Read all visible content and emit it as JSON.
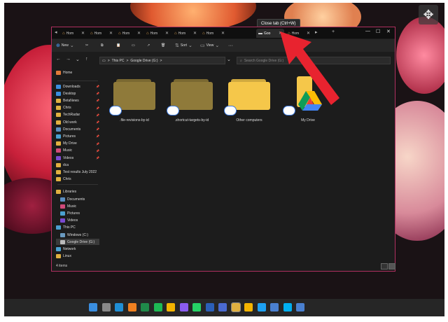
{
  "tooltip": "Close tab (Ctrl+W)",
  "tabs": [
    {
      "label": "Hom",
      "active": false
    },
    {
      "label": "Hom",
      "active": false
    },
    {
      "label": "Hom",
      "active": false
    },
    {
      "label": "Hom",
      "active": false
    },
    {
      "label": "Hom",
      "active": false
    },
    {
      "label": "Hom",
      "active": false
    },
    {
      "label": "Goo",
      "active": true
    },
    {
      "label": "Hom",
      "active": false
    }
  ],
  "toolbar": {
    "new_label": "New",
    "sort_label": "Sort",
    "view_label": "View",
    "more_label": "···"
  },
  "address": {
    "parts": [
      "This PC",
      "Google Drive (G:)"
    ],
    "separator": ">"
  },
  "search": {
    "placeholder": "Search Google Drive (G:)"
  },
  "sidebar": {
    "home": "Home",
    "quick": [
      "Downloads",
      "Desktop",
      "BetaNews",
      "Chris",
      "TechRadar",
      "Old work",
      "Documents",
      "Pictures",
      "My Drive",
      "Music",
      "Videos",
      "dca",
      "Test results July 2022",
      "Chris"
    ],
    "libraries": "Libraries",
    "lib_items": [
      "Documents",
      "Music",
      "Pictures",
      "Videos"
    ],
    "this_pc": "This PC",
    "pc_items": [
      "Windows (C:)",
      "Google Drive (G:)"
    ],
    "network": "Network",
    "linux": "Linux"
  },
  "folders": [
    {
      "label": ".file-revisions-by-id",
      "faded": true
    },
    {
      "label": ".shortcut-targets-by-id",
      "faded": true
    },
    {
      "label": "Other computers",
      "faded": false
    },
    {
      "label": "My Drive",
      "faded": false,
      "drive": true
    }
  ],
  "status": "4 items",
  "colors": {
    "accent": "#b03060",
    "folder": "#f5c74a",
    "folder_faded": "#8f7a3a",
    "arrow": "#e8232f"
  },
  "taskbar_icons": [
    "windows",
    "settings",
    "edge",
    "vlc",
    "excel",
    "spotify",
    "chrome",
    "messenger",
    "whatsapp",
    "word",
    "store",
    "explorer",
    "chrome",
    "twitter",
    "files",
    "skype",
    "photos"
  ]
}
